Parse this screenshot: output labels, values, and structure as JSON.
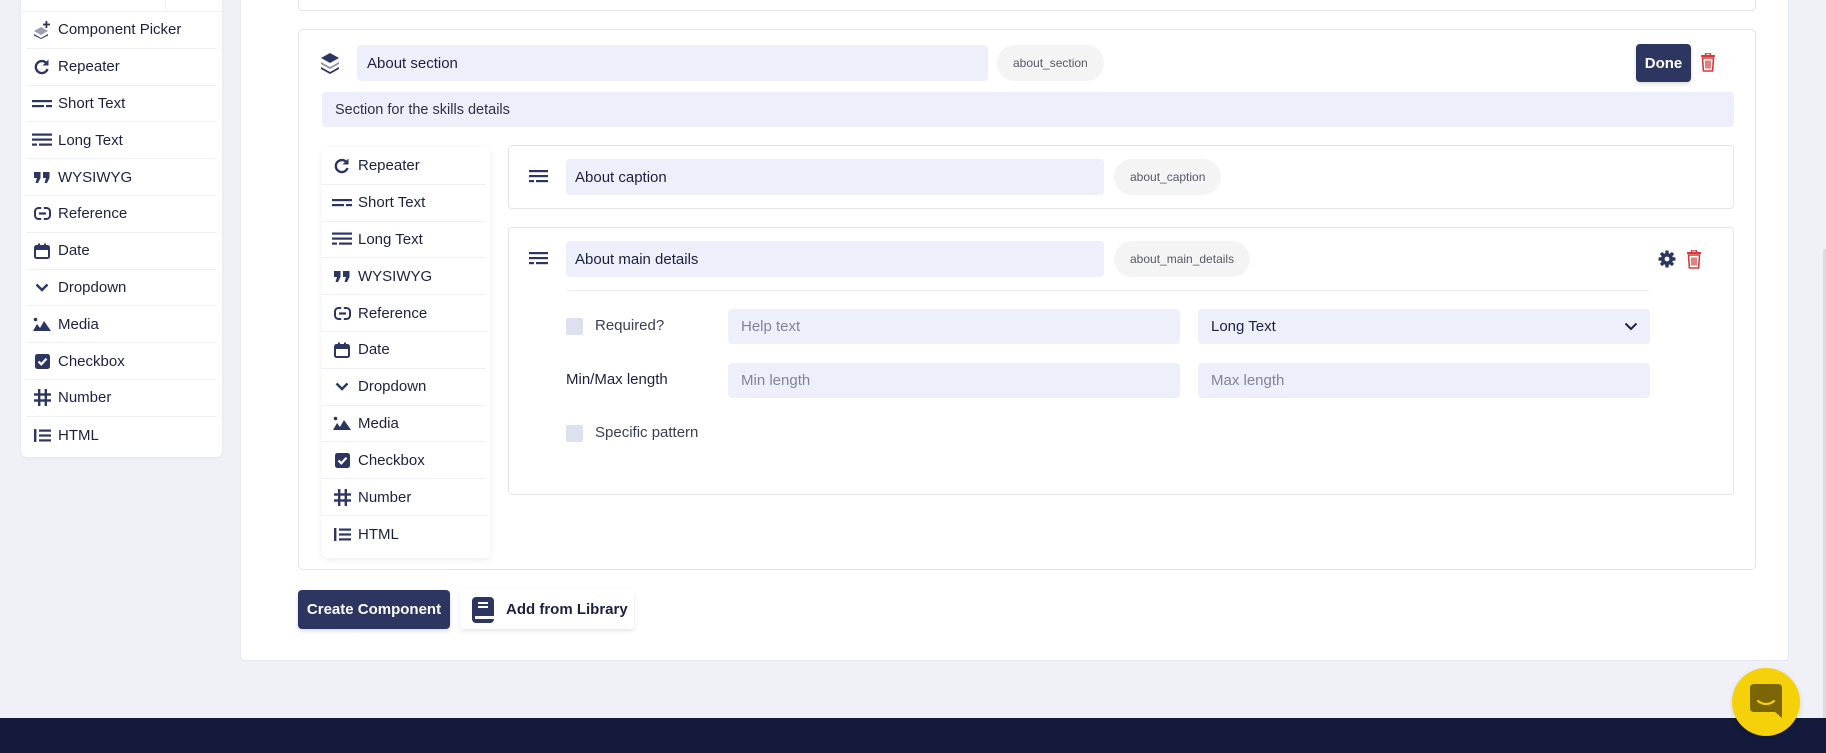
{
  "sidebar": {
    "items": [
      {
        "label": "Component Picker",
        "icon": "component-picker-icon"
      },
      {
        "label": "Repeater",
        "icon": "repeat-icon"
      },
      {
        "label": "Short Text",
        "icon": "short-text-icon"
      },
      {
        "label": "Long Text",
        "icon": "long-text-icon"
      },
      {
        "label": "WYSIWYG",
        "icon": "quote-icon"
      },
      {
        "label": "Reference",
        "icon": "link-icon"
      },
      {
        "label": "Date",
        "icon": "calendar-icon"
      },
      {
        "label": "Dropdown",
        "icon": "chevron-down-icon"
      },
      {
        "label": "Media",
        "icon": "image-icon"
      },
      {
        "label": "Checkbox",
        "icon": "checkbox-icon"
      },
      {
        "label": "Number",
        "icon": "hash-icon"
      },
      {
        "label": "HTML",
        "icon": "list-icon"
      }
    ]
  },
  "section": {
    "title": "About section",
    "key": "about_section",
    "description": "Section for the skills details",
    "done_label": "Done",
    "icon": "layers-icon",
    "types": [
      {
        "label": "Repeater",
        "icon": "repeat-icon"
      },
      {
        "label": "Short Text",
        "icon": "short-text-icon"
      },
      {
        "label": "Long Text",
        "icon": "long-text-icon"
      },
      {
        "label": "WYSIWYG",
        "icon": "quote-icon"
      },
      {
        "label": "Reference",
        "icon": "link-icon"
      },
      {
        "label": "Date",
        "icon": "calendar-icon"
      },
      {
        "label": "Dropdown",
        "icon": "chevron-down-icon"
      },
      {
        "label": "Media",
        "icon": "image-icon"
      },
      {
        "label": "Checkbox",
        "icon": "checkbox-icon"
      },
      {
        "label": "Number",
        "icon": "hash-icon"
      },
      {
        "label": "HTML",
        "icon": "list-icon"
      }
    ],
    "fields": [
      {
        "title": "About caption",
        "key": "about_caption",
        "type_icon": "long-text-icon"
      },
      {
        "title": "About main details",
        "key": "about_main_details",
        "type_icon": "long-text-icon",
        "required_label": "Required?",
        "help_placeholder": "Help text",
        "type_value": "Long Text",
        "minmax_label": "Min/Max length",
        "min_placeholder": "Min length",
        "max_placeholder": "Max length",
        "pattern_label": "Specific pattern"
      }
    ]
  },
  "actions": {
    "create_label": "Create Component",
    "library_label": "Add from Library"
  },
  "colors": {
    "primary": "#2c3660",
    "danger": "#d33a3a",
    "input_bg": "#edf0fa",
    "chat": "#f5d10a",
    "footer": "#141a3c"
  }
}
